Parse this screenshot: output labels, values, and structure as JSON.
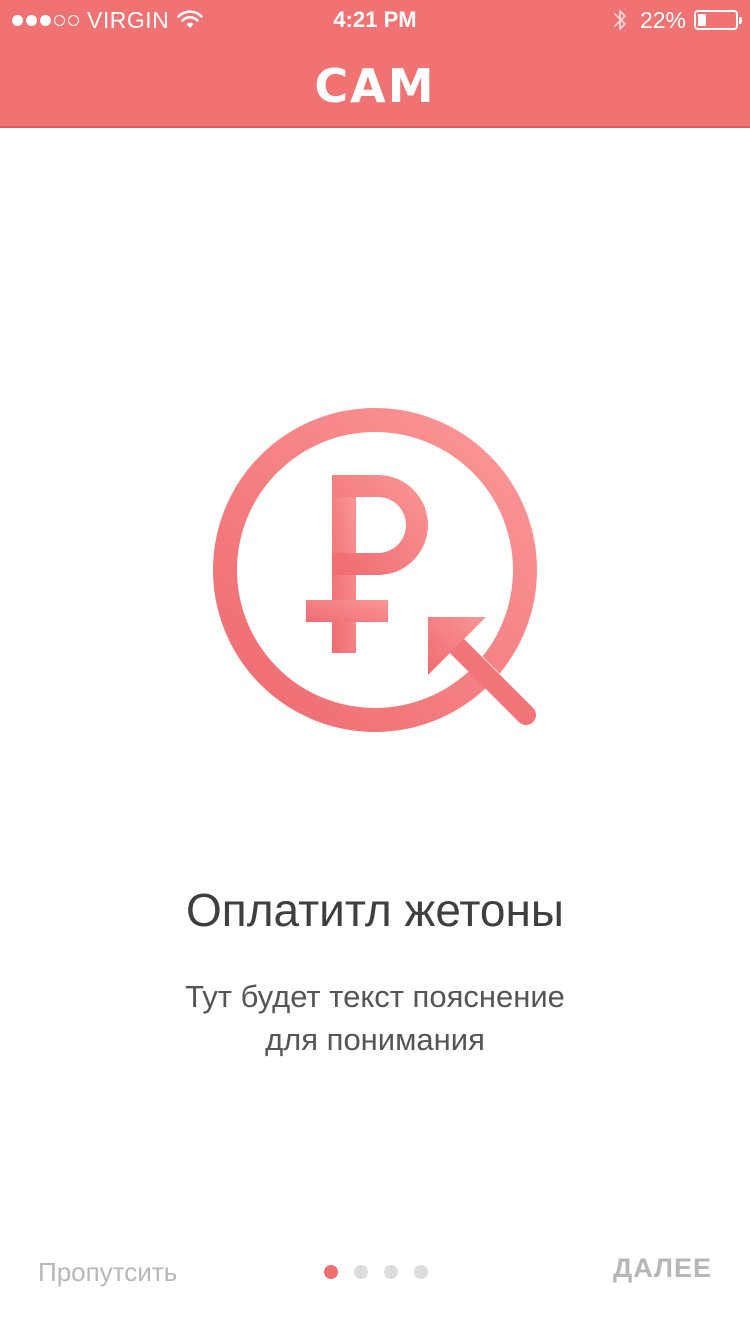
{
  "colors": {
    "header_bg": "#f07272",
    "accent": "#ef6e6e",
    "title_text": "#3f3f3f",
    "muted_text": "#b7b7b7",
    "dot_inactive": "#dcdcdc"
  },
  "status_bar": {
    "signal_bars_filled": 3,
    "signal_bars_total": 5,
    "carrier": "VIRGIN",
    "time": "4:21 PM",
    "battery_percent_text": "22%",
    "battery_level": 0.22,
    "icons": [
      "wifi-icon",
      "bluetooth-icon",
      "battery-icon"
    ]
  },
  "header": {
    "logo_text": "CAM"
  },
  "illustration": {
    "icon": "ruble-payment-icon"
  },
  "onboarding": {
    "title": "Оплатитл жетоны",
    "subtitle_line1": "Тут будет текст пояснение",
    "subtitle_line2": "для понимания"
  },
  "footer": {
    "skip_label": "Пропутсить",
    "next_label": "ДАЛЕЕ",
    "page_count": 4,
    "current_page": 1
  }
}
